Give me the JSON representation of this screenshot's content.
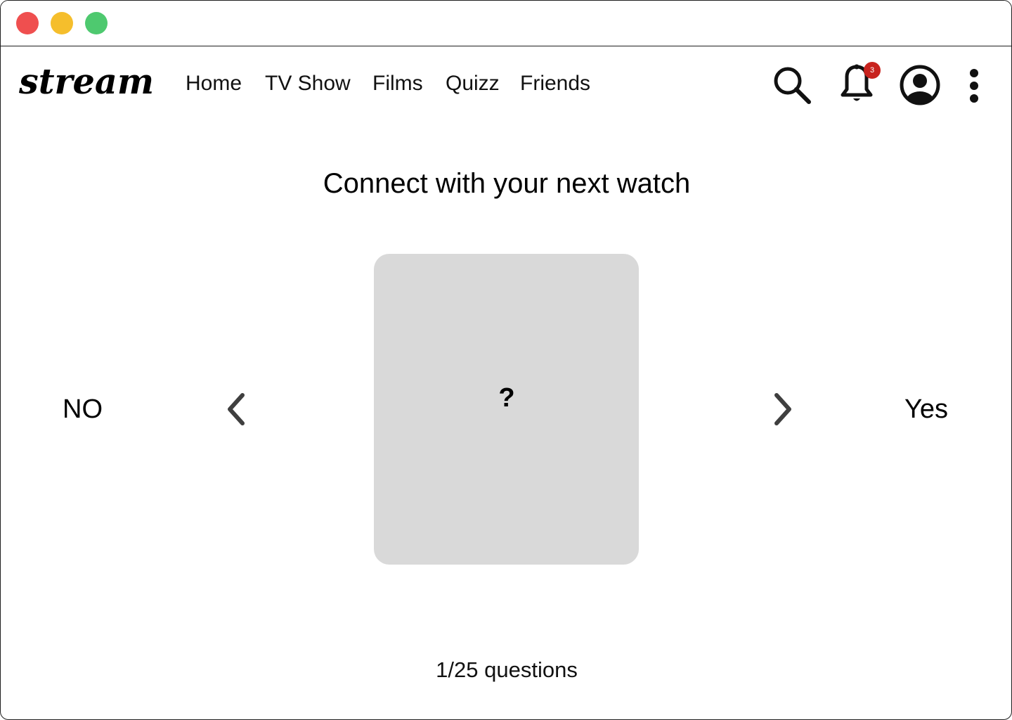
{
  "window": {
    "controls": {
      "close_color": "#EF4F4F",
      "minimize_color": "#F5BE2C",
      "maximize_color": "#4EC96F"
    }
  },
  "header": {
    "logo_text": "stream",
    "nav": [
      "Home",
      "TV Show",
      "Films",
      "Quizz",
      "Friends"
    ],
    "icons": [
      "search-icon",
      "bell-icon",
      "account-circle-icon",
      "more-vertical-icon"
    ],
    "notification_count": "3",
    "badge_color": "#C8231E"
  },
  "main": {
    "title": "Connect with your next watch",
    "no_label": "NO",
    "yes_label": "Yes",
    "card_text": "?",
    "card_color": "#D9D9D9",
    "arrow_color": "#3F3F3F",
    "progress_text": "1/25 questions"
  }
}
